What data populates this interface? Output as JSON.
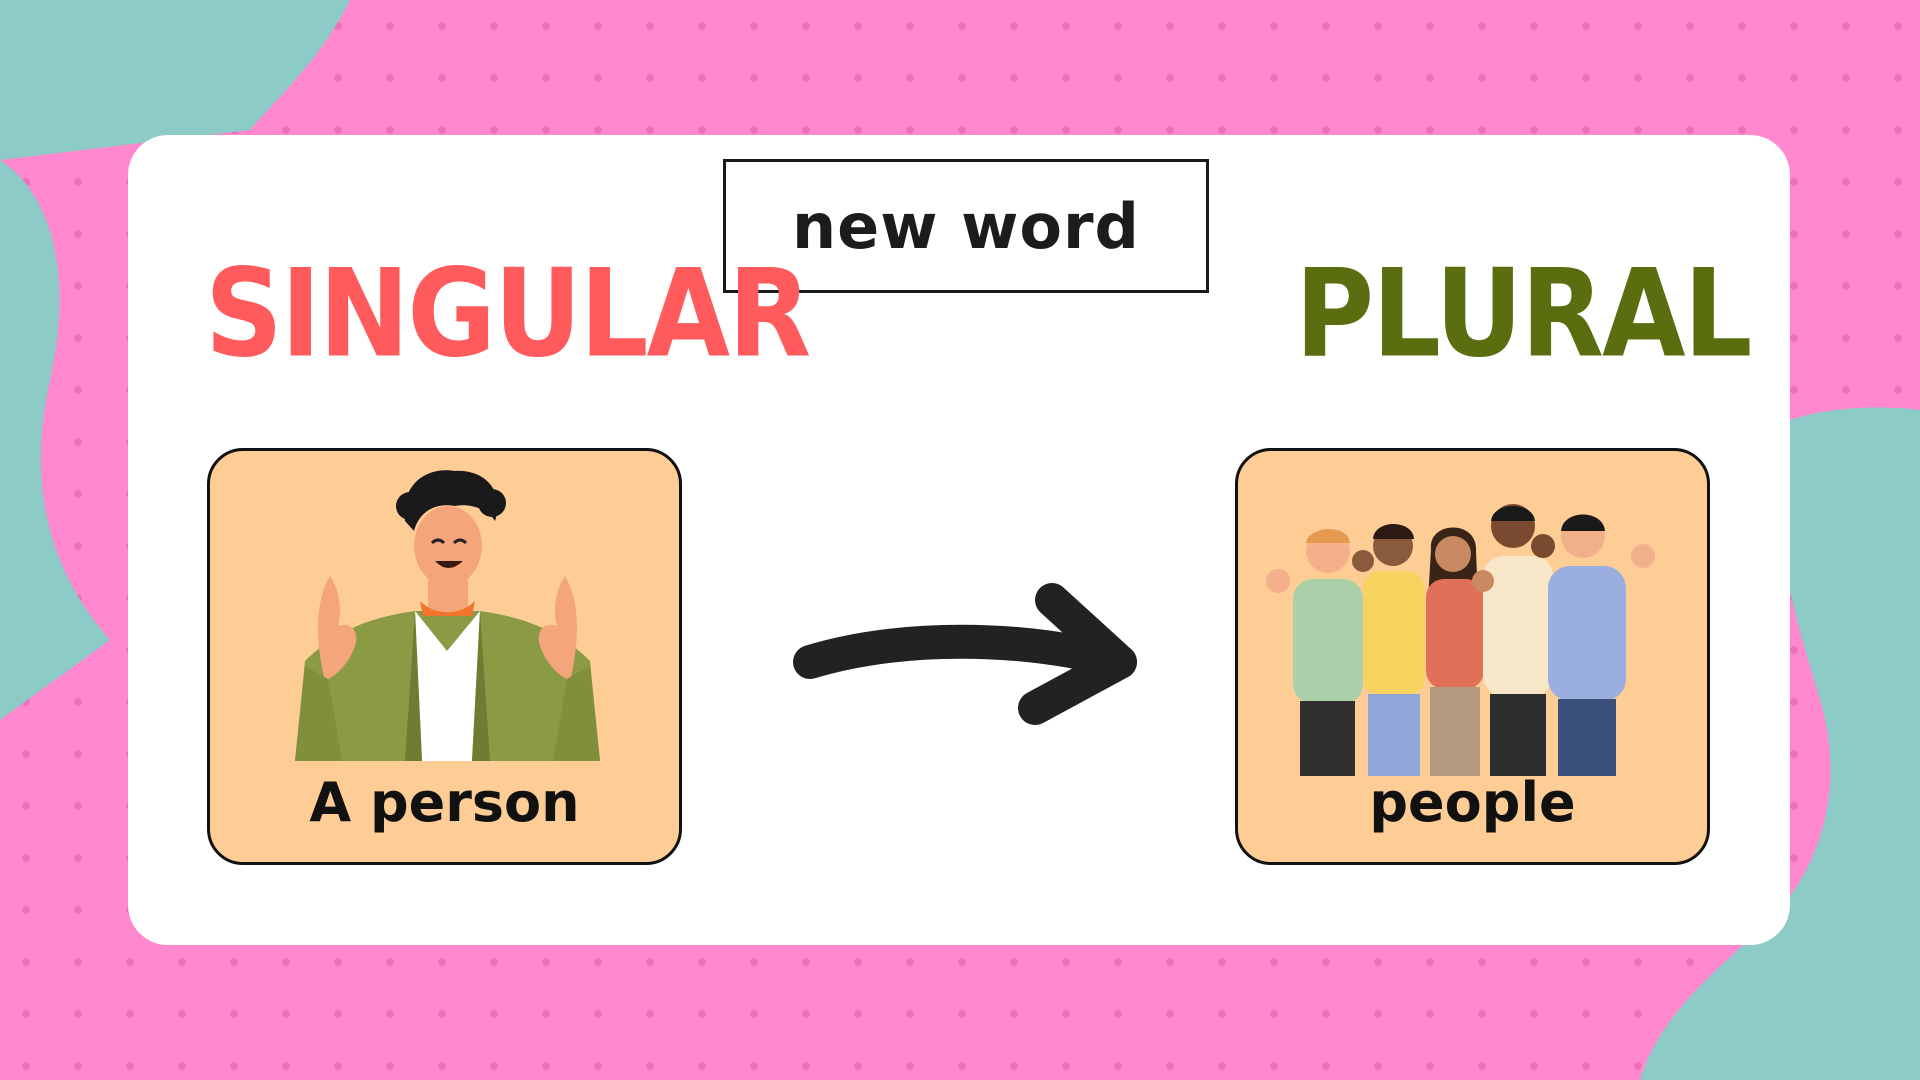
{
  "badge": {
    "text": "new word"
  },
  "singular": {
    "heading": "SINGULAR",
    "caption": "A person",
    "color": "#ff5a5c",
    "illustration": "man-ok-gesture-icon"
  },
  "plural": {
    "heading": "PLURAL",
    "caption": "people",
    "color": "#5a6e10",
    "illustration": "group-of-people-icon"
  },
  "arrow": {
    "icon": "right-arrow-icon"
  },
  "colors": {
    "background": "#ff88cf",
    "blob": "#8ccbc6",
    "card": "#ffffff",
    "panel": "#fecd95"
  }
}
